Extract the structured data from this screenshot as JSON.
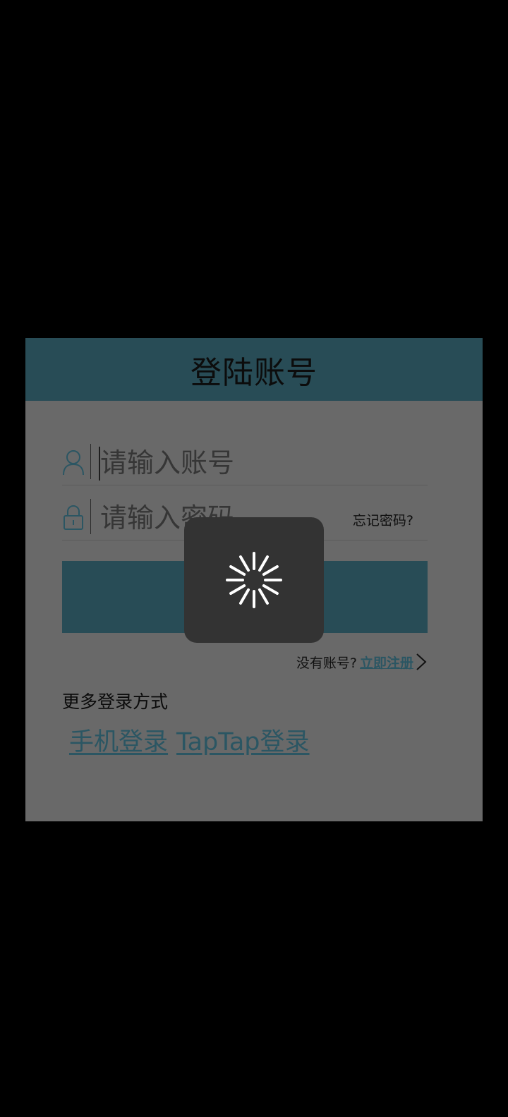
{
  "dialog": {
    "title": "登陆账号",
    "account_placeholder": "请输入账号",
    "password_placeholder": "请输入密码",
    "forgot_password": "忘记密码?",
    "no_account_text": "没有账号?",
    "register_link": "立即注册",
    "more_logins_title": "更多登录方式",
    "alt_logins": [
      "手机登录",
      "TapTap登录"
    ]
  },
  "loading": {
    "icon": "spinner-icon"
  },
  "colors": {
    "header": "#284c56",
    "accent_link": "#2b5663",
    "dialog_bg": "#696969",
    "loading_bg": "#333333"
  }
}
